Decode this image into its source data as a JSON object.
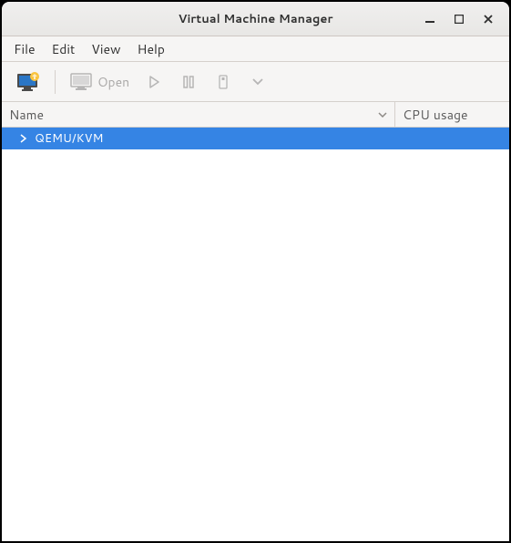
{
  "window": {
    "title": "Virtual Machine Manager"
  },
  "menubar": {
    "items": [
      {
        "label": "File"
      },
      {
        "label": "Edit"
      },
      {
        "label": "View"
      },
      {
        "label": "Help"
      }
    ]
  },
  "toolbar": {
    "open_label": "Open"
  },
  "columns": {
    "name": "Name",
    "cpu": "CPU usage"
  },
  "rows": [
    {
      "label": "QEMU/KVM",
      "selected": true
    }
  ],
  "colors": {
    "selection": "#3584e4"
  }
}
